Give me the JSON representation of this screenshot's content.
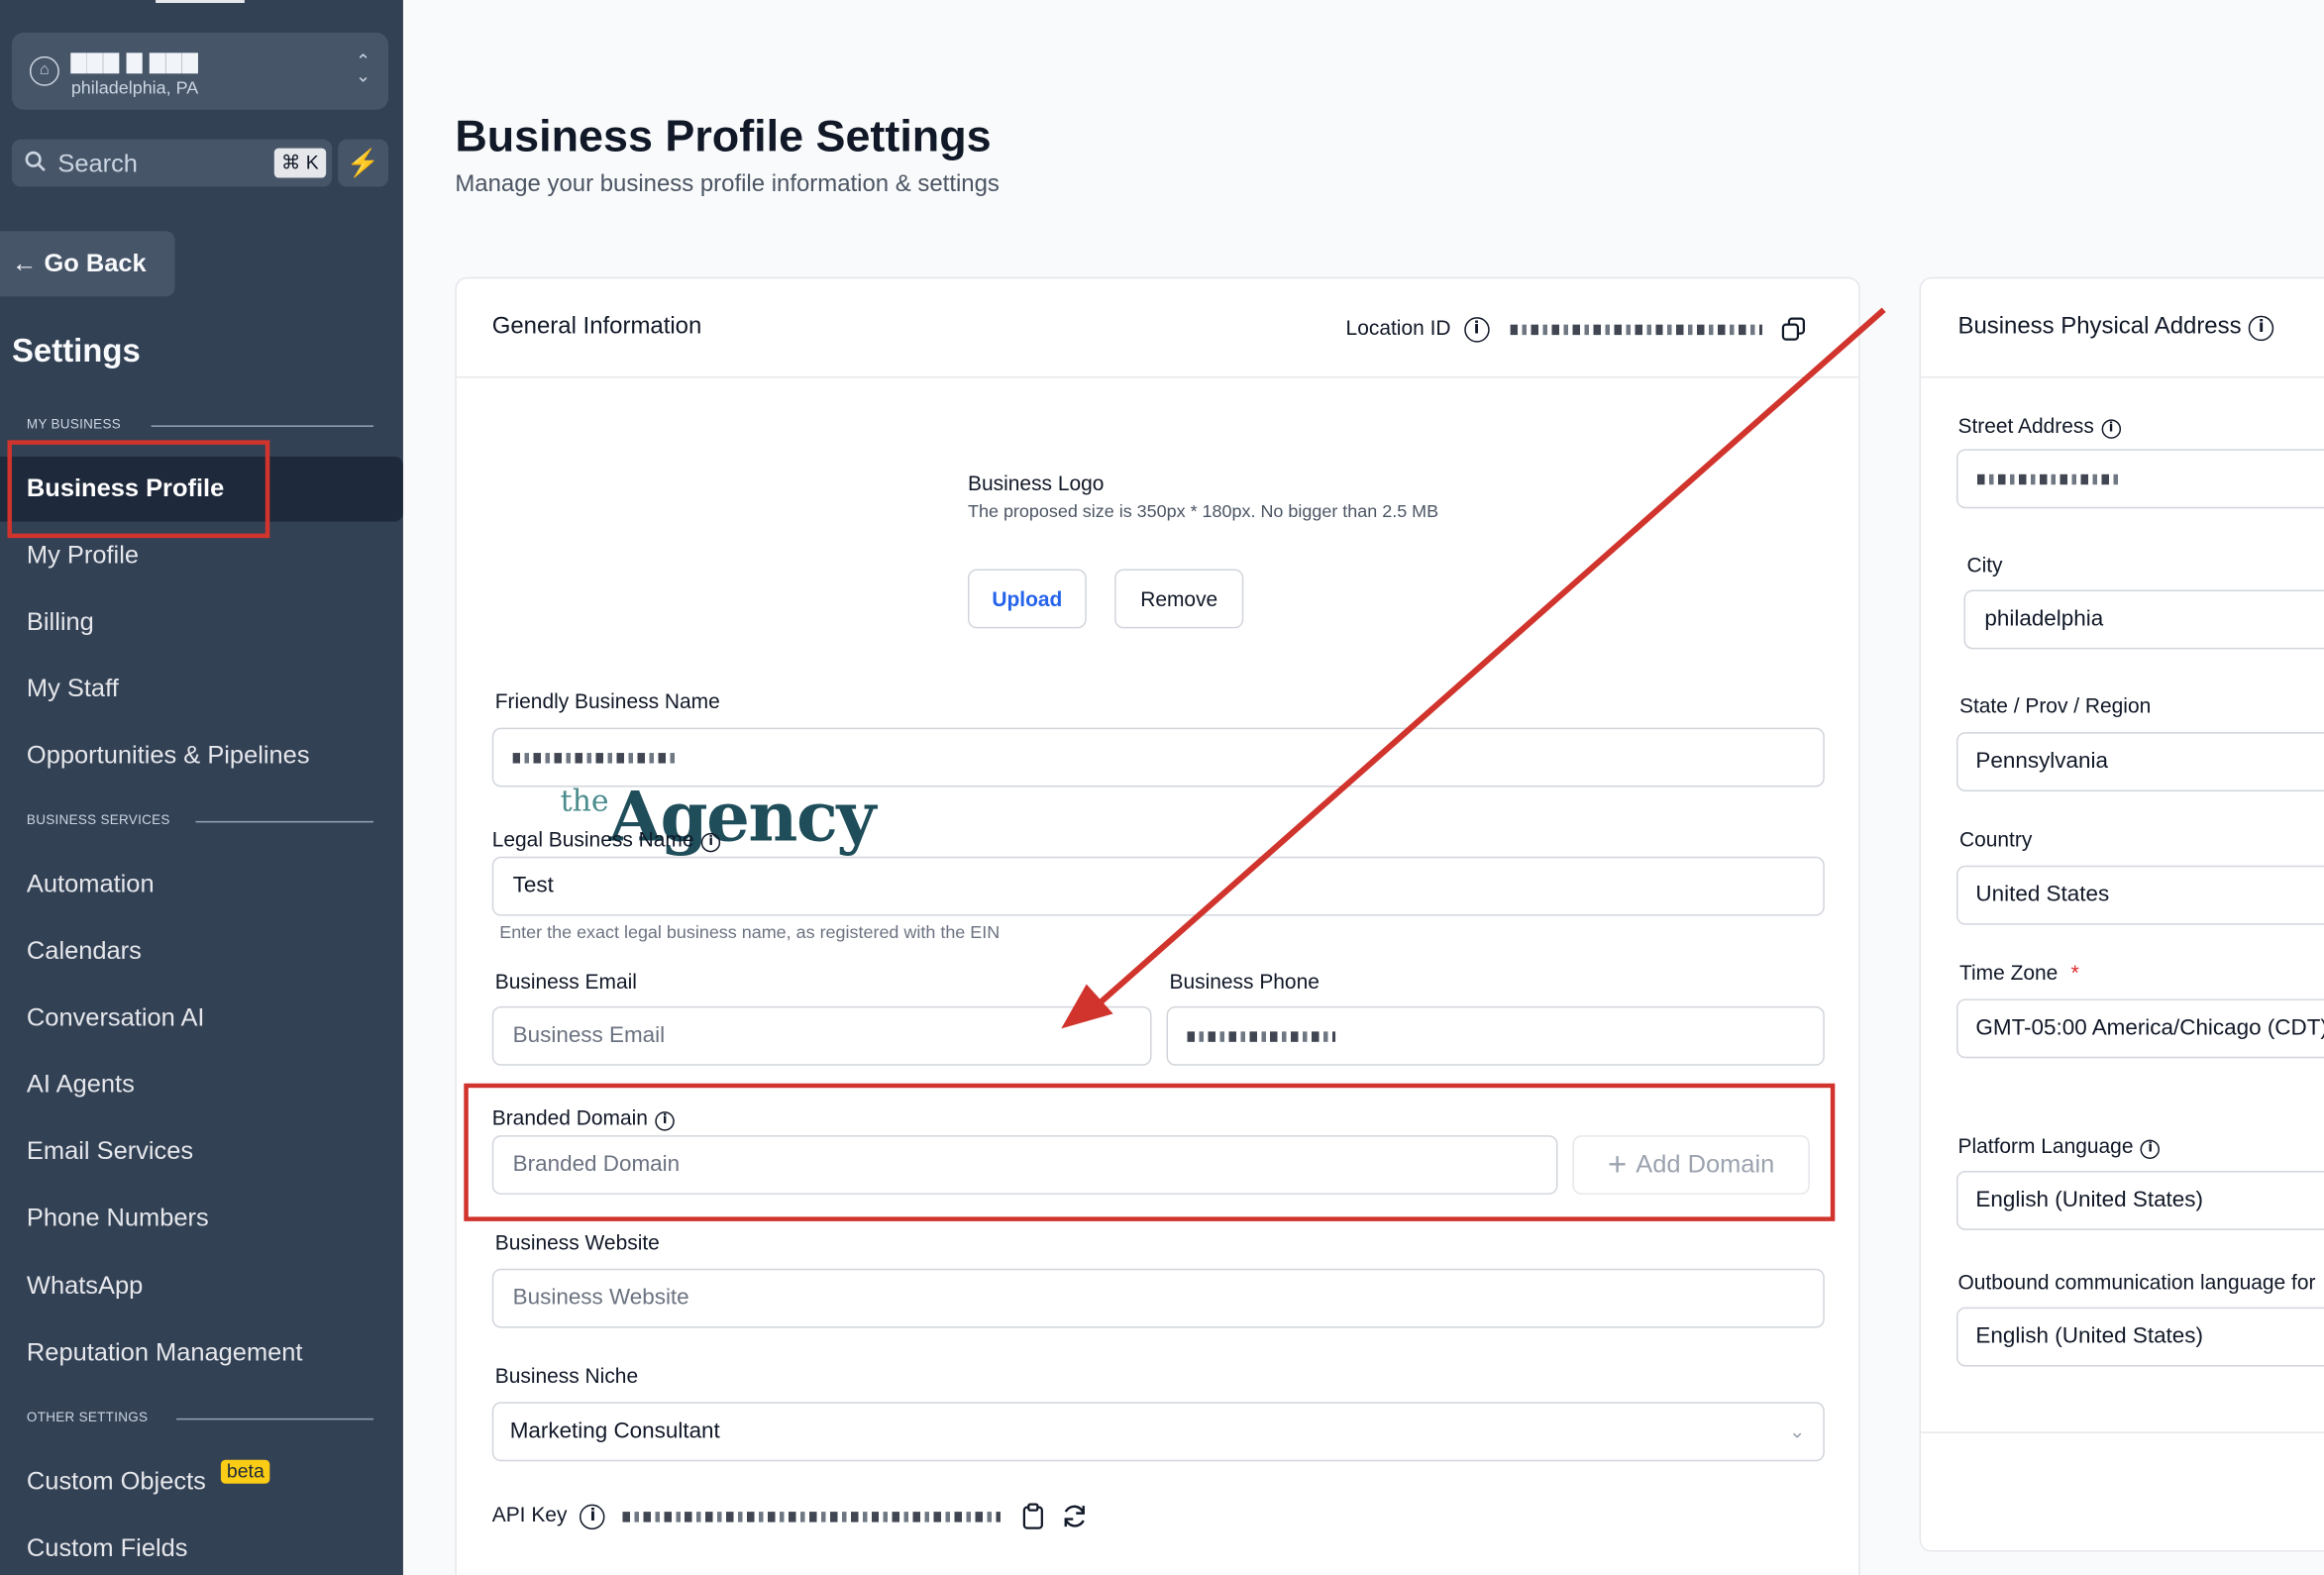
{
  "sidebar": {
    "location_name": "▇▇▇ ▇ ▇▇▇",
    "location_sub": "philadelphia, PA",
    "search_placeholder": "Search",
    "search_shortcut": "⌘ K",
    "go_back": "Go Back",
    "title": "Settings",
    "section_my_business": "MY BUSINESS",
    "section_business_services": "BUSINESS SERVICES",
    "section_other_settings": "OTHER SETTINGS",
    "items_my_business": [
      "Business Profile",
      "My Profile",
      "Billing",
      "My Staff",
      "Opportunities & Pipelines"
    ],
    "items_business_services": [
      "Automation",
      "Calendars",
      "Conversation AI",
      "AI Agents",
      "Email Services",
      "Phone Numbers",
      "WhatsApp",
      "Reputation Management"
    ],
    "items_other_settings": [
      "Custom Objects",
      "Custom Fields"
    ],
    "beta_badge": "beta",
    "active_item": "Business Profile"
  },
  "page": {
    "title": "Business Profile Settings",
    "subtitle": "Manage your business profile information & settings"
  },
  "general": {
    "title": "General Information",
    "location_id_label": "Location ID",
    "logo_the": "the",
    "logo_agency": "Agency",
    "logo_label": "Business Logo",
    "logo_hint": "The proposed size is 350px * 180px. No bigger than 2.5 MB",
    "upload_label": "Upload",
    "remove_label": "Remove",
    "friendly_name_label": "Friendly Business Name",
    "legal_name_label": "Legal Business Name",
    "legal_name_value": "Test",
    "legal_name_hint": "Enter the exact legal business name, as registered with the EIN",
    "email_label": "Business Email",
    "email_placeholder": "Business Email",
    "phone_label": "Business Phone",
    "branded_domain_label": "Branded Domain",
    "branded_domain_placeholder": "Branded Domain",
    "add_domain_label": "Add Domain",
    "website_label": "Business Website",
    "website_placeholder": "Business Website",
    "niche_label": "Business Niche",
    "niche_value": "Marketing Consultant",
    "api_key_label": "API Key"
  },
  "address": {
    "title": "Business Physical Address",
    "street_label": "Street Address",
    "city_label": "City",
    "city_value": "philadelphia",
    "state_label": "State / Prov / Region",
    "state_value": "Pennsylvania",
    "country_label": "Country",
    "country_value": "United States",
    "timezone_label": "Time Zone",
    "timezone_required": "*",
    "timezone_value": "GMT-05:00 America/Chicago (CDT)",
    "platform_lang_label": "Platform Language",
    "platform_lang_value": "English (United States)",
    "outbound_lang_label": "Outbound communication language for",
    "outbound_lang_value": "English (United States)"
  },
  "colors": {
    "sidebar_bg": "#334155",
    "annotation_red": "#d0342c",
    "primary_blue": "#2563eb"
  }
}
